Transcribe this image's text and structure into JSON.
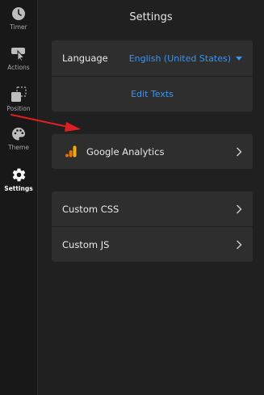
{
  "sidebar": {
    "items": [
      {
        "label": "Timer",
        "icon": "clock-icon",
        "active": false
      },
      {
        "label": "Actions",
        "icon": "cursor-click-icon",
        "active": false
      },
      {
        "label": "Position",
        "icon": "position-icon",
        "active": false
      },
      {
        "label": "Theme",
        "icon": "palette-icon",
        "active": false
      },
      {
        "label": "Settings",
        "icon": "gear-icon",
        "active": true
      }
    ]
  },
  "header": {
    "title": "Settings"
  },
  "general": {
    "language_label": "Language",
    "language_value": "English (United States)",
    "edit_texts": "Edit Texts"
  },
  "integrations": {
    "google_analytics": "Google Analytics"
  },
  "custom": {
    "css": "Custom CSS",
    "js": "Custom JS"
  },
  "colors": {
    "accent": "#3a95ef",
    "annotation_arrow": "#e02020",
    "analytics_orange": "#f9ab00"
  }
}
